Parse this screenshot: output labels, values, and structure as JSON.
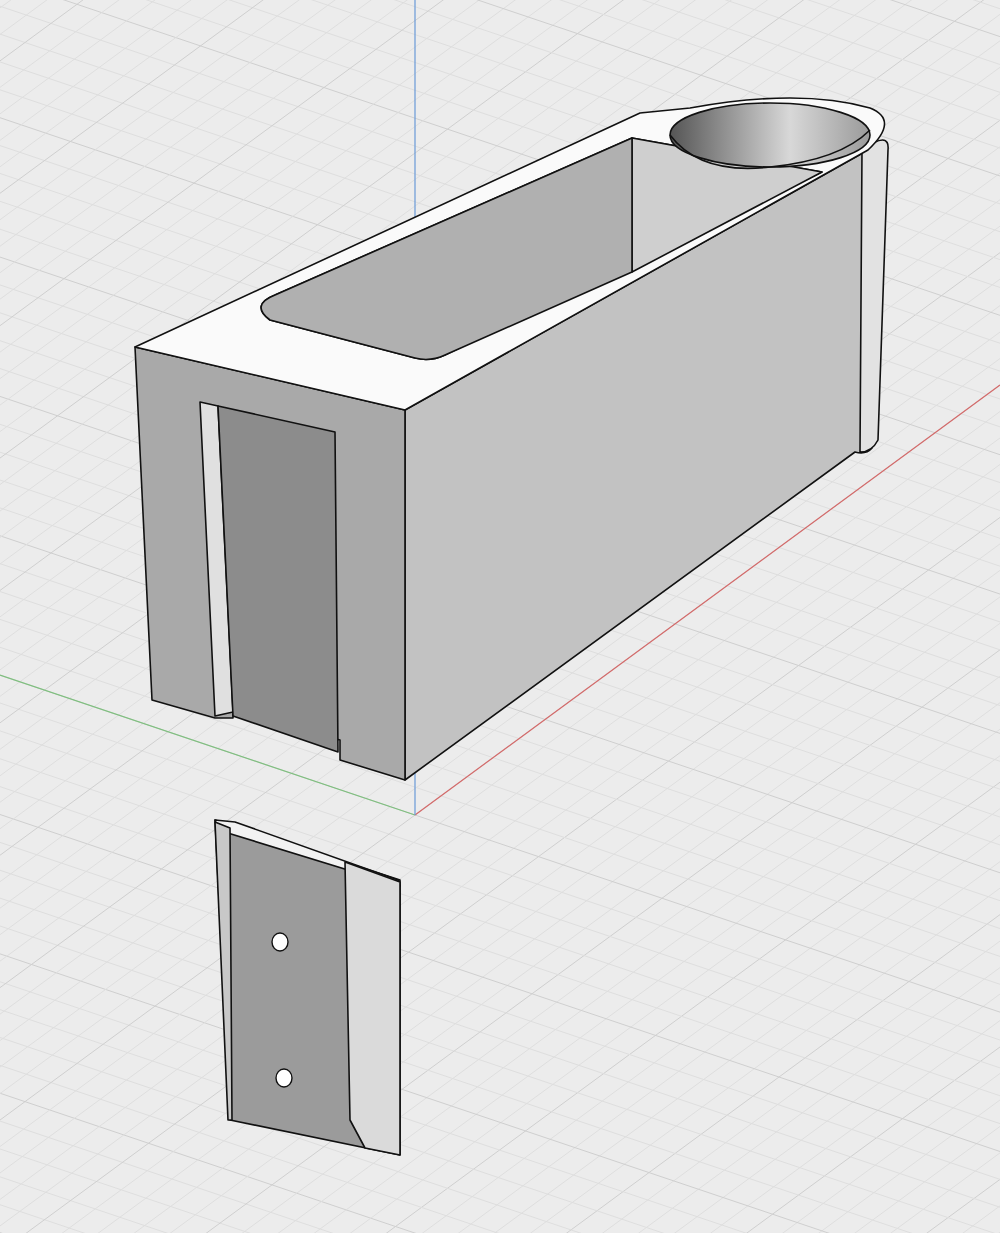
{
  "viewport": {
    "grid": true,
    "axes": [
      {
        "kind": "x"
      },
      {
        "kind": "y"
      },
      {
        "kind": "z"
      }
    ]
  }
}
